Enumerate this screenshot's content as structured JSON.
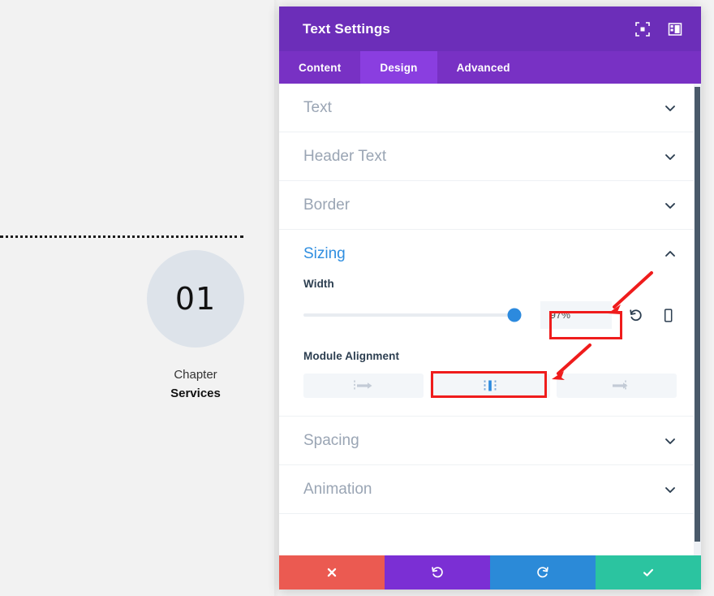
{
  "preview": {
    "divider": "dotted-rule",
    "chapter_number": "01",
    "chapter_label": "Chapter",
    "chapter_title": "Services"
  },
  "modal": {
    "title": "Text Settings",
    "header_icons": [
      {
        "name": "focus-icon",
        "label": "Focus"
      },
      {
        "name": "layout-panel-icon",
        "label": "Panel Layout"
      }
    ],
    "tabs": [
      {
        "label": "Content",
        "active": false
      },
      {
        "label": "Design",
        "active": true
      },
      {
        "label": "Advanced",
        "active": false
      }
    ],
    "sections": [
      {
        "title": "Text",
        "open": false
      },
      {
        "title": "Header Text",
        "open": false
      },
      {
        "title": "Border",
        "open": false
      },
      {
        "title": "Sizing",
        "open": true
      },
      {
        "title": "Spacing",
        "open": false
      },
      {
        "title": "Animation",
        "open": false
      }
    ],
    "sizing": {
      "width_label": "Width",
      "width_value": "97%",
      "width_percent": 97,
      "reset_icon": "reset-icon",
      "device_icon": "mobile-device-icon",
      "alignment_label": "Module Alignment",
      "alignment_options": [
        {
          "name": "align-left",
          "selected": false
        },
        {
          "name": "align-center",
          "selected": true
        },
        {
          "name": "align-right",
          "selected": false
        }
      ]
    },
    "footer": [
      {
        "name": "cancel-button",
        "icon": "close-icon",
        "color": "#eb5a51"
      },
      {
        "name": "undo-button",
        "icon": "undo-icon",
        "color": "#7b2fd4"
      },
      {
        "name": "redo-button",
        "icon": "redo-icon",
        "color": "#2b8ad8"
      },
      {
        "name": "save-button",
        "icon": "check-icon",
        "color": "#2bc4a0"
      }
    ]
  },
  "annotations": {
    "highlight_color": "#ef1c1c",
    "boxes": [
      "width-value-field",
      "module-alignment-center-button"
    ],
    "arrows": [
      "arrow-to-width-field",
      "arrow-to-align-center"
    ]
  },
  "colors": {
    "header_purple": "#6c2eb9",
    "tabbar_purple": "#7831c4",
    "tab_active_purple": "#8a3ee0",
    "accent_blue": "#2f8ee0",
    "circle_gray": "#dde3ea"
  }
}
